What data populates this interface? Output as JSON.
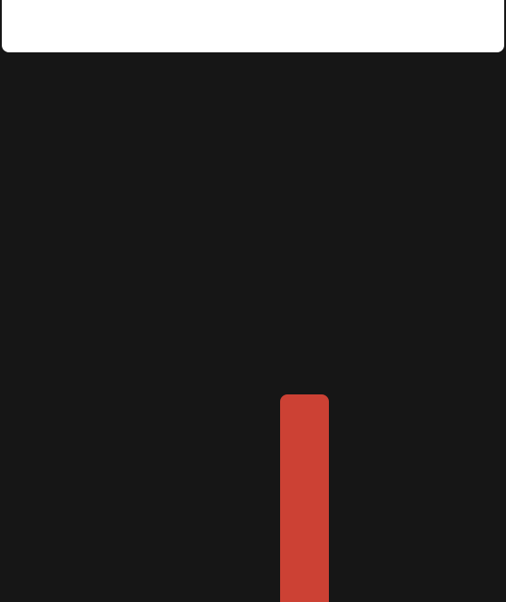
{
  "top_bar": {
    "text": ""
  },
  "colors": {
    "background": "#161616",
    "top_bar": "#ffffff",
    "red_bar": "#cc4134"
  }
}
